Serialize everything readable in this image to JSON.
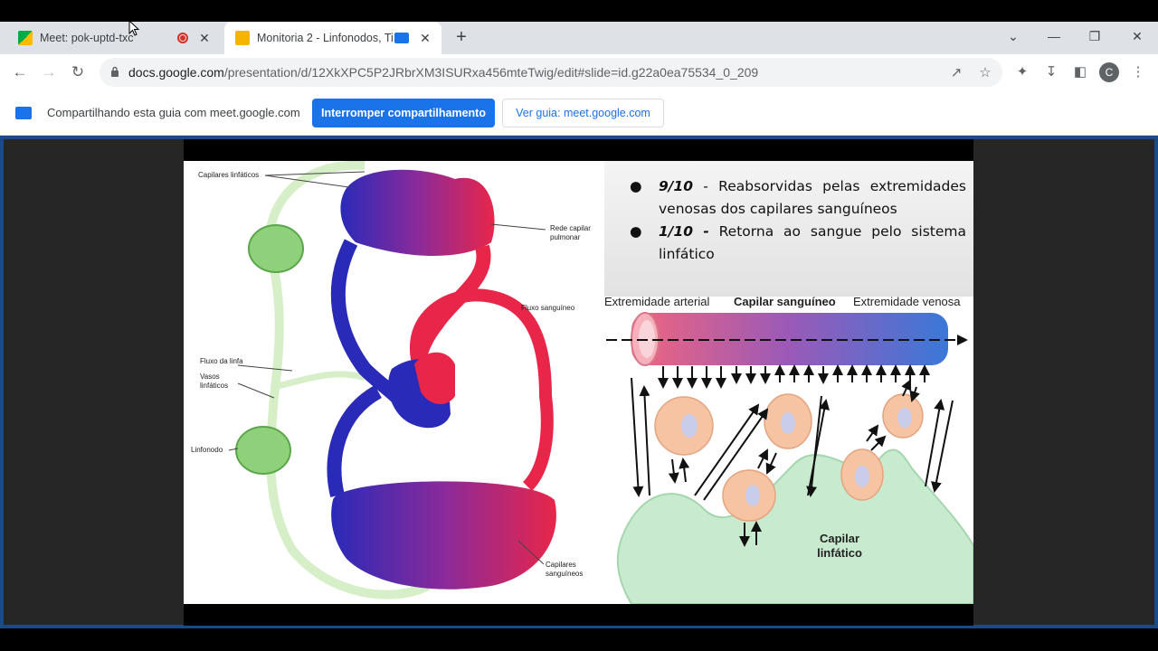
{
  "browser": {
    "tabs": [
      {
        "title": "Meet: pok-uptd-txc",
        "icon": "google-meet-icon",
        "active": false,
        "close": "✕"
      },
      {
        "title": "Monitoria 2 - Linfonodos, Ti",
        "icon": "google-slides-icon",
        "active": true,
        "close": "✕"
      }
    ],
    "new_tab": "+",
    "url_domain": "docs.google.com",
    "url_path": "/presentation/d/12XkXPC5P2JRbrXM3ISURxa456mteTwig/edit#slide=id.g22a0ea75534_0_209",
    "avatar_letter": "C"
  },
  "share_bar": {
    "text": "Compartilhando esta guia com meet.google.com",
    "stop_button": "Interromper compartilhamento",
    "view_button": "Ver guia: meet.google.com"
  },
  "slide": {
    "left_diagram": {
      "labels": {
        "lymph_capillaries": "Capilares linfáticos",
        "pulmonary_network": "Rede capilar pulmonar",
        "blood_flow": "Fluxo sanguíneo",
        "lymph_flow": "Fluxo da linfa",
        "lymph_vessels": "Vasos linfáticos",
        "lymph_node": "Linfonodo",
        "blood_capillaries": "Capilares sanguíneos"
      }
    },
    "bullets": [
      {
        "bold": "9/10",
        "text": "- Reabsorvidas pelas extremidades venosas dos capilares sanguíneos"
      },
      {
        "bold": "1/10 -",
        "text": "Retorna ao sangue pelo sistema linfático"
      }
    ],
    "right_diagram": {
      "arterial_end": "Extremidade arterial",
      "capillary": "Capilar sanguíneo",
      "venous_end": "Extremidade venosa",
      "lymph_capillary": "Capilar linfático"
    }
  },
  "colors": {
    "accent": "#1a73e8",
    "artery_red": "#e8264a",
    "vein_blue": "#2a2ab8",
    "lymph_green": "#8fd17a",
    "cell": "#f6c3a3"
  }
}
